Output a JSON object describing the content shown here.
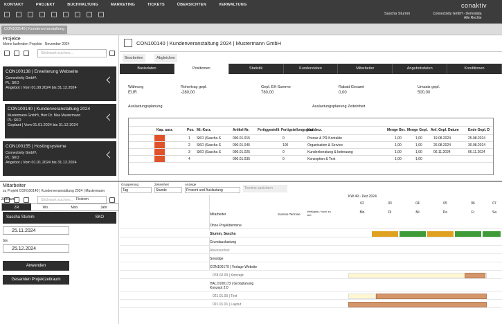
{
  "topmenu": [
    "KONTAKT",
    "PROJEKT",
    "BUCHHALTUNG",
    "MARKETING",
    "TICKETS",
    "ÜBERSICHTEN",
    "VERWALTUNG"
  ],
  "user": "Sascha Stumm",
  "company1": "Connectivity GmbH - Demodata",
  "company2": "Alle Rechte",
  "brand": "conaktiv",
  "doctab": "CON100140 | Kundenveranstaltung",
  "projects": {
    "title": "Projekte",
    "filter": "Meine laufenden Projekte",
    "month": "November 2024",
    "search": "Stichwort suchen...",
    "cards": [
      {
        "t": "CON100138 | Erweiterung Webseite",
        "l1": "Connectivity GmbH\\",
        "l2": "PL: SKO",
        "p": "Angebot",
        "d": "Vom 01.09.2024 bis 31.12.2024"
      },
      {
        "t": "CON100140 | Kundenveranstaltung 2024",
        "l1": "Mustermann GmbH\\, Herr Dr. Max Mustermann",
        "l2": "PL: SKO",
        "p": "Geplant",
        "d": "Vom 01.01.2024 bis 31.12.2024"
      },
      {
        "t": "CON100155 | Hostingsysteme",
        "l1": "Connectivity GmbH\\",
        "l2": "PL: SKO",
        "p": "Angebot",
        "d": "Vom 01.01.2024 bis 31.12.2024"
      }
    ]
  },
  "main": {
    "title": "CON100140 | Kundenveranstaltung 2024 | Mustermann GmbH",
    "edit": "Bearbeiten",
    "sync": "Abgleichen",
    "tabs": [
      "Basisdaten",
      "Positionen",
      "Statistik",
      "Kundendaten",
      "Mitarbeiter",
      "Angebotsdaten",
      "Konditionen"
    ],
    "f": [
      [
        "Währung",
        "EUR"
      ],
      [
        "Rohertrag gepl.",
        "-280,00"
      ],
      [
        "Gepl. EK-Summe",
        "780,00"
      ],
      [
        "Rabatt Gesamt",
        "0,00"
      ],
      [
        "Umsatz gepl.",
        "500,00"
      ]
    ],
    "auslast": "Auslastungsplanung",
    "auslastz": "Auslastungsplanung Zeiteinheit",
    "gridhead": [
      "Kap. ausr.",
      "Pos.",
      "Mi.-Kurz.",
      "Artikel-Nr.",
      "Fertiggestellt",
      "Fertigstellungsgrad",
      "Kurzbez.",
      "Menge Ber.",
      "Menge Gepl.",
      "Anf. Gepl. Datum",
      "Ende Gepl. D"
    ],
    "rows": [
      [
        "1",
        "SKO (Sascha S",
        "090.01.015",
        "0",
        "Presse & PR-Kontakte",
        "1,00",
        "1,00",
        "19.08.2024",
        "25.08.2024"
      ],
      [
        "2",
        "SKO (Sascha S",
        "090.01.045",
        "100",
        "Organisation & Service",
        "1,00",
        "1,00",
        "26.08.2024",
        "30.08.2024"
      ],
      [
        "3",
        "SKO (Sascha S",
        "090.01.025",
        "0",
        "Kundenberatung & betreuung",
        "1,00",
        "1,00",
        "06.11.2024",
        "06.11.2024"
      ],
      [
        "4",
        "",
        "090.01.035",
        "0",
        "Konzeption & Text",
        "1,00",
        "1,00",
        "",
        ""
      ]
    ]
  },
  "staff": {
    "title": "Mitarbeiter",
    "ref": "zu Projekt CON100140 | Kundenveranstaltung 2024 | Mustermann",
    "search": "Stichwort suchen...",
    "name": "Sascha Stumm",
    "code": "SKO"
  },
  "time": {
    "label": "Zeitraum",
    "fix": "Fixieren",
    "tabs": [
      "ZR",
      "Wo.",
      "Mon.",
      "Jahr"
    ],
    "von": "von",
    "bis": "bis",
    "d1": "25.11.2024",
    "d2": "25.12.2024",
    "apply": "Anwenden",
    "total": "Gesamten Projektzeitraum"
  },
  "gantt": {
    "grp": "Gruppierung",
    "grpv": "Tag",
    "zeit": "Zeiteinheit",
    "zeitv": "Stunde",
    "anz": "Anzeige",
    "anzv": "Prozent und Auslastung",
    "save": "Termine speichern",
    "kw": "KW 49 - Dez 2024",
    "days": [
      "02",
      "03",
      "04",
      "05",
      "06",
      "07"
    ],
    "dn": [
      "Mo",
      "Di",
      "Mi",
      "Do",
      "Fr",
      "Sa"
    ],
    "ma": "Mitarbeiter",
    "sum": "Summe Termine",
    "verf": "Verfügbar / noch zu verl.",
    "rows": [
      "Ohne Projekttermine",
      "Stumm, Sascha",
      "Grundauslastung",
      "Abwesenheit",
      "Sonstige",
      "CON100179 | Vorlage Website",
      "078.02.00 | Konzept",
      "HALO100173 | Grobplanung Konzept 2.0",
      "021.01.00 | Text",
      "021.01.01 | Layout"
    ]
  }
}
